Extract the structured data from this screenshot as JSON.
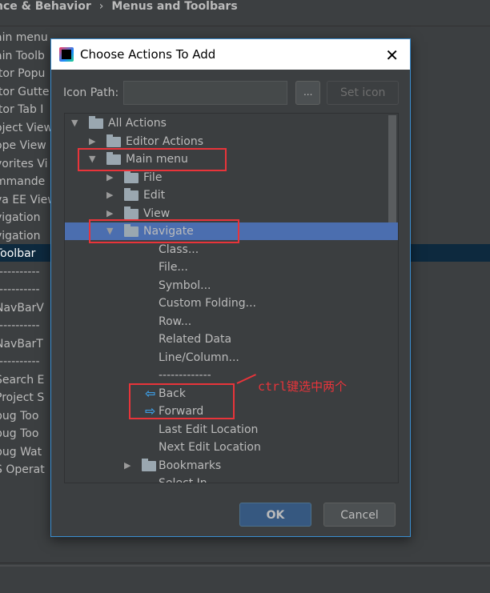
{
  "breadcrumb": {
    "parent": "nce & Behavior",
    "separator": "›",
    "current": "Menus and Toolbars"
  },
  "background_list": [
    "ain menu",
    "ain Toolb",
    "itor Popu",
    "itor Gutte",
    "itor Tab I",
    "oject View",
    "ope View",
    "vorites Vi",
    "mmande",
    "va EE View",
    "vigation",
    "vigation",
    "Toolbar",
    "-----------",
    "-----------",
    "NavBarV",
    "-----------",
    "NavBarT",
    "-----------",
    "Search E",
    "Project S",
    "bug Too",
    "bug Too",
    "bug Wat",
    "S Operat"
  ],
  "background_selected_index": 12,
  "dialog": {
    "title": "Choose Actions To Add",
    "icon_path_label": "Icon Path:",
    "icon_path_value": "",
    "browse_label": "...",
    "set_icon_label": "Set icon",
    "ok_label": "OK",
    "cancel_label": "Cancel",
    "tree": [
      {
        "label": "All Actions",
        "level": 0,
        "expanded": true,
        "folder": true
      },
      {
        "label": "Editor Actions",
        "level": 1,
        "expanded": false,
        "folder": true
      },
      {
        "label": "Main menu",
        "level": 1,
        "expanded": true,
        "folder": true
      },
      {
        "label": "File",
        "level": 2,
        "expanded": false,
        "folder": true
      },
      {
        "label": "Edit",
        "level": 2,
        "expanded": false,
        "folder": true
      },
      {
        "label": "View",
        "level": 2,
        "expanded": false,
        "folder": true
      },
      {
        "label": "Navigate",
        "level": 2,
        "expanded": true,
        "folder": true,
        "selected": true
      },
      {
        "label": "Class...",
        "level": 3
      },
      {
        "label": "File...",
        "level": 3
      },
      {
        "label": "Symbol...",
        "level": 3
      },
      {
        "label": "Custom Folding...",
        "level": 3
      },
      {
        "label": "Row...",
        "level": 3
      },
      {
        "label": "Related Data",
        "level": 3
      },
      {
        "label": "Line/Column...",
        "level": 3
      },
      {
        "label": "-------------",
        "level": 3
      },
      {
        "label": "Back",
        "level": 3,
        "icon": "back-arrow-icon"
      },
      {
        "label": "Forward",
        "level": 3,
        "icon": "forward-arrow-icon"
      },
      {
        "label": "Last Edit Location",
        "level": 3
      },
      {
        "label": "Next Edit Location",
        "level": 3
      },
      {
        "label": "Bookmarks",
        "level": 3,
        "expanded": false,
        "folder": true
      },
      {
        "label": "Select In...",
        "level": 3
      }
    ]
  },
  "annotation": {
    "text": "ctrl键选中两个",
    "color": "#e8343a"
  },
  "colors": {
    "selection": "#4b6eaf",
    "ok_button": "#365880",
    "dialog_border": "#3a8ed0",
    "annotation_red": "#e8343a"
  }
}
